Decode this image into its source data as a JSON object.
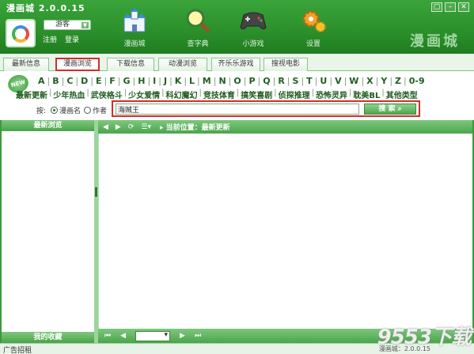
{
  "app": {
    "title": "漫画城 2.0.0.15",
    "window_controls": [
      "▢",
      "–",
      "✕"
    ]
  },
  "user": {
    "dropdown_value": "游客",
    "login": "注册",
    "register": "登录"
  },
  "nav": [
    {
      "label": "漫画城",
      "icon": "castle-icon"
    },
    {
      "label": "查字典",
      "icon": "magnifier-icon"
    },
    {
      "label": "小游戏",
      "icon": "gamepad-icon"
    },
    {
      "label": "设置",
      "icon": "gear-icon"
    }
  ],
  "brand_text": "漫画城",
  "tabs": [
    "最新信息",
    "漫画浏览",
    "下载信息",
    "动漫浏览",
    "齐乐乐游戏",
    "搜视电影"
  ],
  "active_tab": "漫画浏览",
  "letters": [
    "A",
    "B",
    "C",
    "D",
    "E",
    "F",
    "G",
    "H",
    "I",
    "J",
    "K",
    "L",
    "M",
    "N",
    "O",
    "P",
    "Q",
    "R",
    "S",
    "T",
    "U",
    "V",
    "W",
    "X",
    "Y",
    "Z",
    "0-9"
  ],
  "categories": [
    "最新更新",
    "少年热血",
    "武侠格斗",
    "少女爱情",
    "科幻魔幻",
    "竞技体育",
    "搞笑喜剧",
    "侦探推理",
    "恐怖灵异",
    "耽美BL",
    "其他类型"
  ],
  "new_badge": "NEW",
  "search": {
    "by_label": "按:",
    "options": [
      {
        "label": "漫画名",
        "selected": true
      },
      {
        "label": "作者",
        "selected": false
      }
    ],
    "value": "海贼王",
    "button_label": "搜 索"
  },
  "left_panel": {
    "header": "最新浏览",
    "footer": "我的收藏"
  },
  "toolbar": {
    "location": "当前位置：最新更新"
  },
  "status": {
    "ad": "广告招租",
    "version": "漫画城：2.0.0.15"
  },
  "watermark": "9553下载",
  "colors": {
    "header_green": "#2b8f2b",
    "highlight_red": "#d42c2c",
    "accent_green": "#4aa54a"
  }
}
